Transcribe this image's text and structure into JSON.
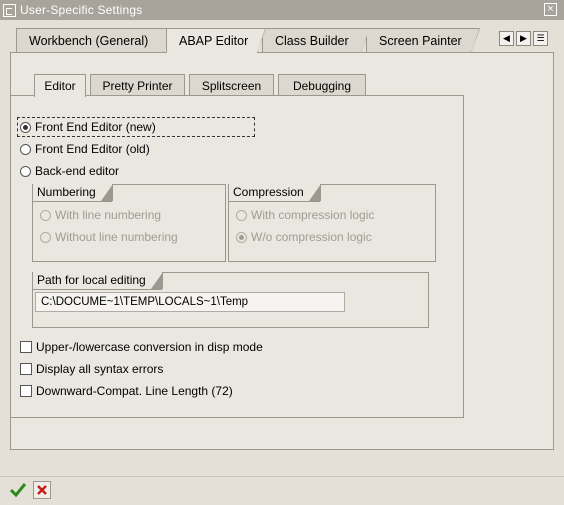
{
  "window": {
    "title": "User-Specific Settings"
  },
  "main_tabs": [
    {
      "label": "Workbench (General)"
    },
    {
      "label": "ABAP Editor"
    },
    {
      "label": "Class Builder"
    },
    {
      "label": "Screen Painter"
    }
  ],
  "sub_tabs": [
    {
      "label": "Editor"
    },
    {
      "label": "Pretty Printer"
    },
    {
      "label": "Splitscreen"
    },
    {
      "label": "Debugging"
    }
  ],
  "editor_options": [
    {
      "label": "Front End Editor (new)",
      "checked": true
    },
    {
      "label": "Front End Editor (old)",
      "checked": false
    },
    {
      "label": "Back-end editor",
      "checked": false
    }
  ],
  "numbering": {
    "title": "Numbering",
    "options": [
      {
        "label": "With line numbering",
        "checked": false
      },
      {
        "label": "Without line numbering",
        "checked": false
      }
    ]
  },
  "compression": {
    "title": "Compression",
    "options": [
      {
        "label": "With compression logic",
        "checked": false
      },
      {
        "label": "W/o compression logic",
        "checked": true
      }
    ]
  },
  "local_path": {
    "title": "Path for local editing",
    "value": "C:\\DOCUME~1\\TEMP\\LOCALS~1\\Temp"
  },
  "checkboxes": [
    {
      "label": "Upper-/lowercase conversion in disp mode",
      "checked": false
    },
    {
      "label": "Display all syntax errors",
      "checked": false
    },
    {
      "label": "Downward-Compat. Line Length (72)",
      "checked": false
    }
  ],
  "icons": {
    "confirm": "check-icon",
    "cancel": "cancel-icon",
    "confirm_color": "#2a8a1c",
    "cancel_color": "#c81c1c"
  }
}
